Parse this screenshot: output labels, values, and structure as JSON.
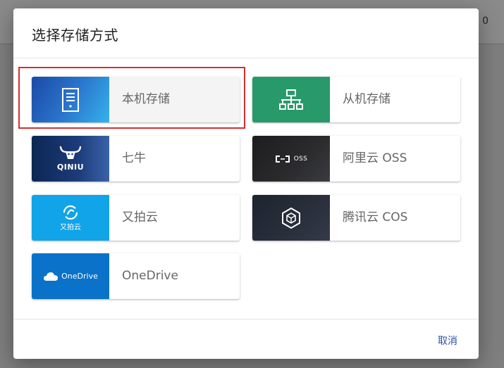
{
  "background": {
    "count": "0"
  },
  "dialog": {
    "title": "选择存储方式",
    "cancel_label": "取消"
  },
  "storages": [
    {
      "label": "本机存储",
      "icon": "server-icon",
      "selected": true,
      "color": "#2a74cc"
    },
    {
      "label": "从机存储",
      "icon": "network-icon",
      "selected": false,
      "color": "#28996a"
    },
    {
      "label": "七牛",
      "icon": "qiniu-logo",
      "logo_text": "QINIU",
      "selected": false,
      "color": "#1c3c7a"
    },
    {
      "label": "阿里云 OSS",
      "icon": "aliyun-oss-logo",
      "logo_text": "OSS",
      "selected": false,
      "color": "#2b2b2e"
    },
    {
      "label": "又拍云",
      "icon": "upyun-logo",
      "logo_text": "又拍云",
      "selected": false,
      "color": "#11a4e8"
    },
    {
      "label": "腾讯云 COS",
      "icon": "tencent-cos-logo",
      "selected": false,
      "color": "#2a2f3c"
    },
    {
      "label": "OneDrive",
      "icon": "onedrive-logo",
      "logo_text": "OneDrive",
      "selected": false,
      "color": "#0a72c8"
    }
  ],
  "colors": {
    "selection_outline": "#d32f2f",
    "link": "#2a4fa8"
  }
}
